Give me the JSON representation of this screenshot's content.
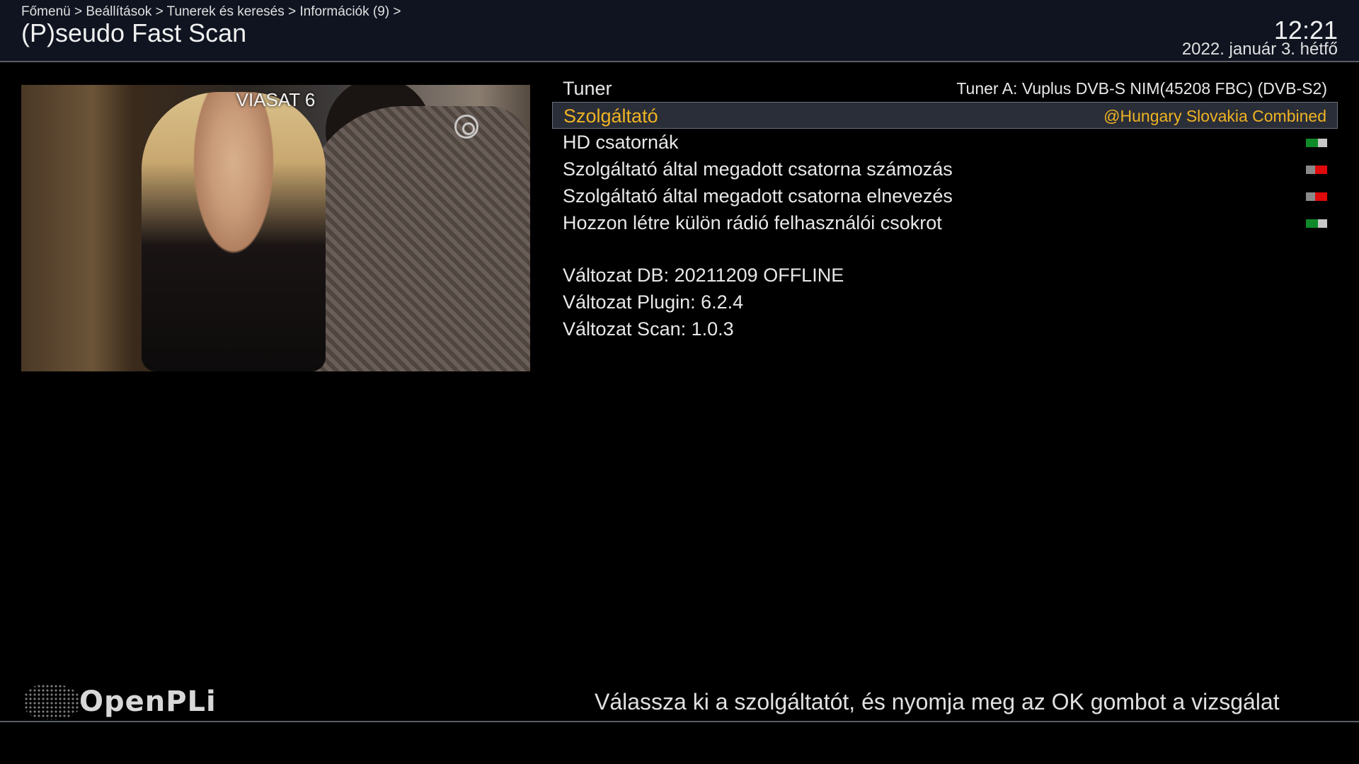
{
  "header": {
    "breadcrumb": "Főmenü > Beállítások > Tunerek és keresés > Információk (9) >",
    "title": "(P)seudo Fast Scan",
    "time": "12:21",
    "date": "2022. január  3. hétfő"
  },
  "preview": {
    "channel": "VIASAT 6"
  },
  "settings": {
    "tuner": {
      "label": "Tuner",
      "value": "Tuner A: Vuplus DVB-S NIM(45208 FBC) (DVB-S2)"
    },
    "provider": {
      "label": "Szolgáltató",
      "value": "@Hungary Slovakia Combined"
    },
    "hd_channels": {
      "label": "HD csatornák",
      "state": "on"
    },
    "numbering": {
      "label": "Szolgáltató által megadott csatorna számozás",
      "state": "off"
    },
    "naming": {
      "label": "Szolgáltató által megadott csatorna elnevezés",
      "state": "off"
    },
    "radio_bouquets": {
      "label": "Hozzon létre külön rádió felhasználói csokrot",
      "state": "on"
    }
  },
  "info": {
    "db": "Változat DB:  20211209 OFFLINE",
    "plugin": "Változat Plugin:  6.2.4",
    "scan": "Változat Scan:  1.0.3"
  },
  "footer": {
    "brand": "OpenPLi",
    "hint": "Válassza ki a szolgáltatót, és nyomja meg az OK gombot a vizsgálat"
  },
  "colors": {
    "highlight": "#f0b323",
    "toggle_on": "#0f8a2a",
    "toggle_off": "#e00a0a",
    "header_bg": "#0f1420"
  },
  "icons": {
    "channel_logo": "viasat-logo-icon",
    "brand_logo": "openpli-globe-icon"
  }
}
